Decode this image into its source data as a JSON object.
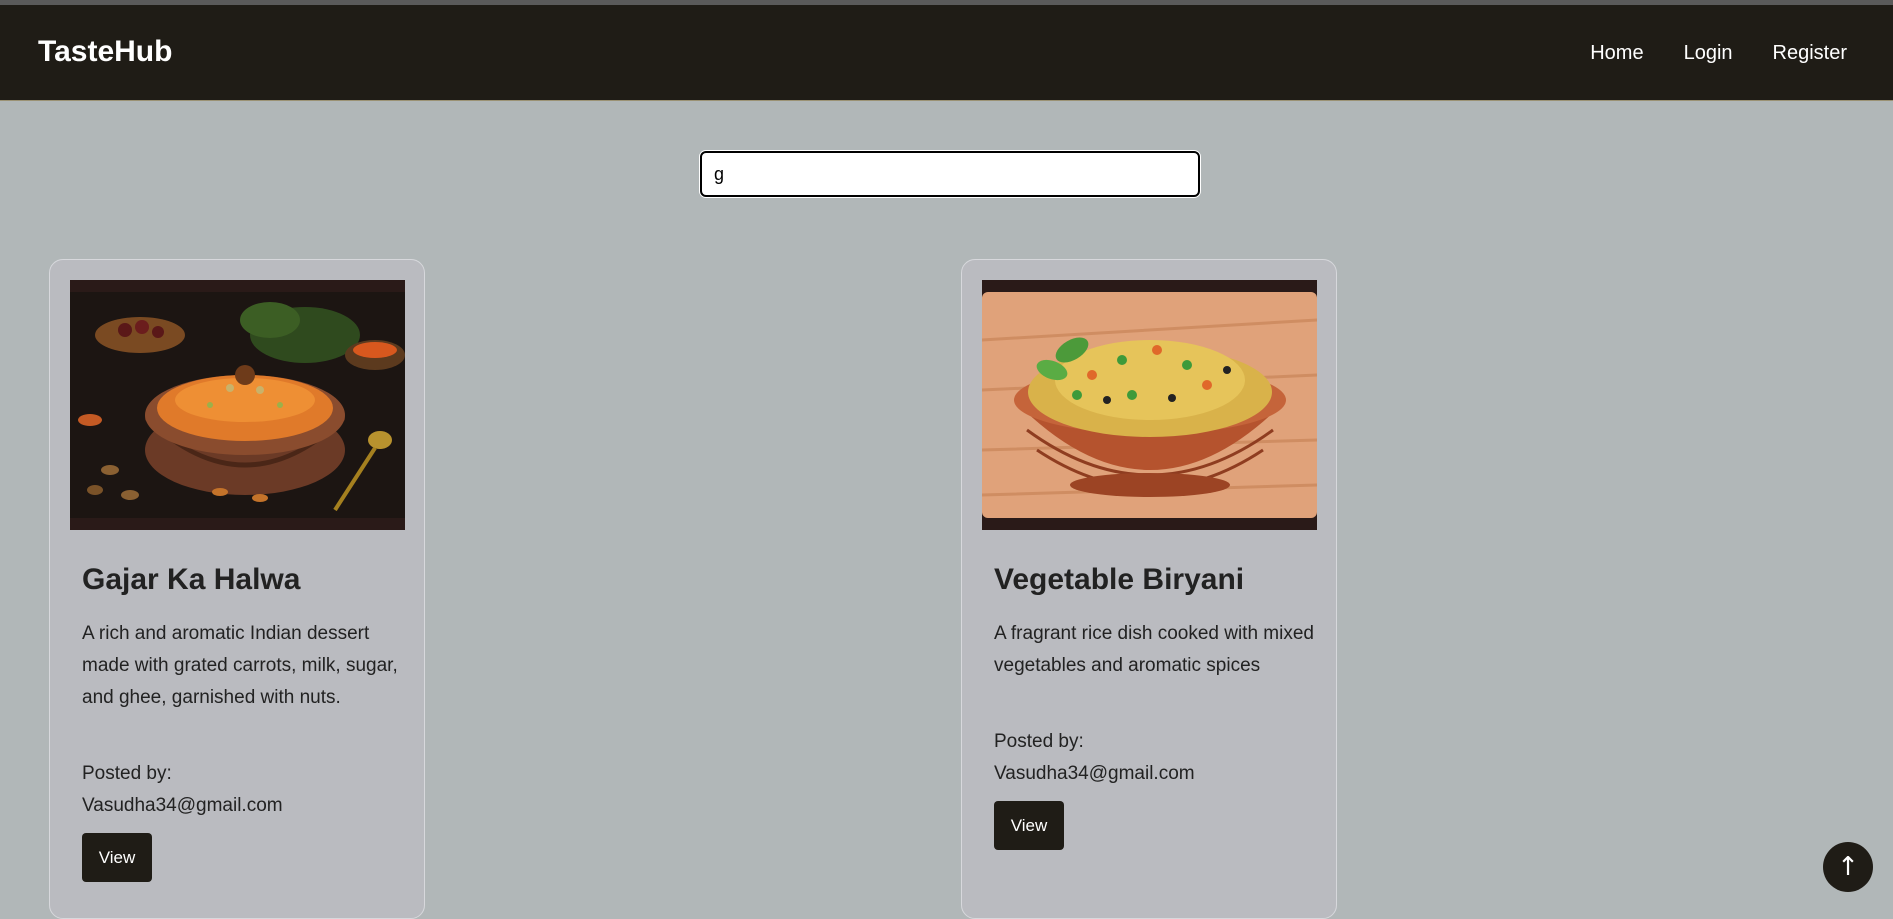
{
  "brand": "TasteHub",
  "nav": {
    "home": "Home",
    "login": "Login",
    "register": "Register"
  },
  "search": {
    "value": "g"
  },
  "recipes": [
    {
      "title": "Gajar Ka Halwa",
      "description": "A rich and aromatic Indian dessert made with grated carrots, milk, sugar, and ghee, garnished with nuts.",
      "posted_label": "Posted by:",
      "posted_by": "Vasudha34@gmail.com",
      "button": "View"
    },
    {
      "title": "Vegetable Biryani",
      "description": "A fragrant rice dish cooked with mixed vegetables and aromatic spices",
      "posted_label": "Posted by:",
      "posted_by": "Vasudha34@gmail.com",
      "button": "View"
    }
  ],
  "scroll_top": {
    "icon": "arrow-up-icon",
    "glyph": "↑"
  },
  "colors": {
    "navbar": "#1f1c16",
    "page_bg": "#b1b7b8",
    "card_bg": "#babbc0",
    "button": "#1f1c16"
  }
}
